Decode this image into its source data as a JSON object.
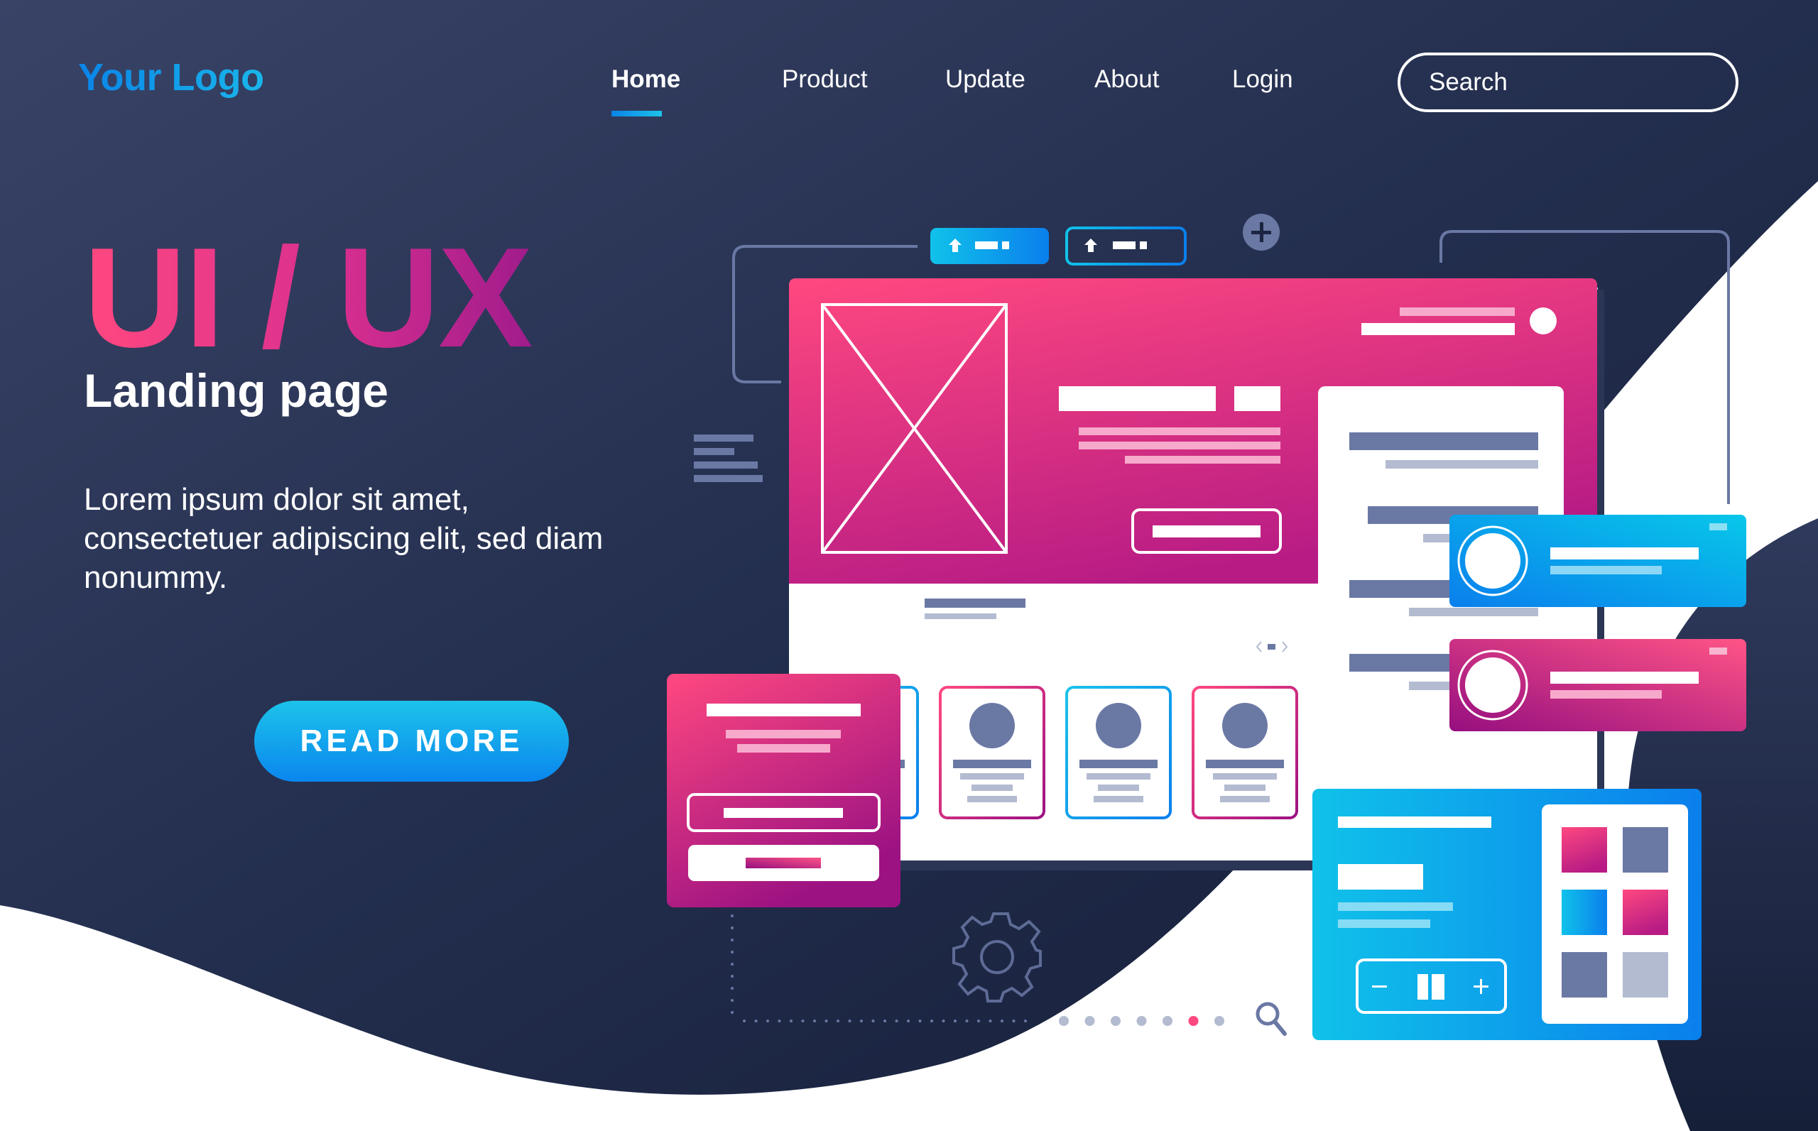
{
  "header": {
    "logo": "Your Logo",
    "nav": [
      {
        "label": "Home",
        "active": true
      },
      {
        "label": "Product",
        "active": false
      },
      {
        "label": "Update",
        "active": false
      },
      {
        "label": "About",
        "active": false
      },
      {
        "label": "Login",
        "active": false
      }
    ],
    "search": {
      "placeholder": "Search",
      "value": "",
      "icon": "search-icon"
    }
  },
  "hero": {
    "title": "UI / UX",
    "subtitle": "Landing page",
    "body": "Lorem ipsum dolor sit amet, consectetuer adipiscing elit, sed diam nonummy.",
    "cta_label": "READ MORE"
  },
  "illustration": {
    "tabs": [
      {
        "style": "filled",
        "icon": "upload-arrow-icon"
      },
      {
        "style": "outline",
        "icon": "upload-arrow-icon"
      }
    ],
    "icons": [
      "plus-icon",
      "gear-icon",
      "magnifier-icon",
      "image-placeholder-icon",
      "chevron-left-icon",
      "chevron-right-icon"
    ],
    "profile_cards_count": 4,
    "pagination": {
      "dots": 7,
      "active_index": 5
    },
    "stepper": {
      "minus": "−",
      "plus": "+"
    },
    "swatches": [
      "#ff4880",
      "#6a78a4",
      "#1cc3ea",
      "#ff4880",
      "#6a78a4",
      "#b3bbd0"
    ]
  },
  "colors": {
    "background_dark": "#1c2541",
    "pink": "#ff4880",
    "magenta": "#a01c8c",
    "cyan": "#1cc3ea",
    "blue": "#0a84e8",
    "slate": "#6a78a4",
    "slate_light": "#b3bbd0"
  }
}
